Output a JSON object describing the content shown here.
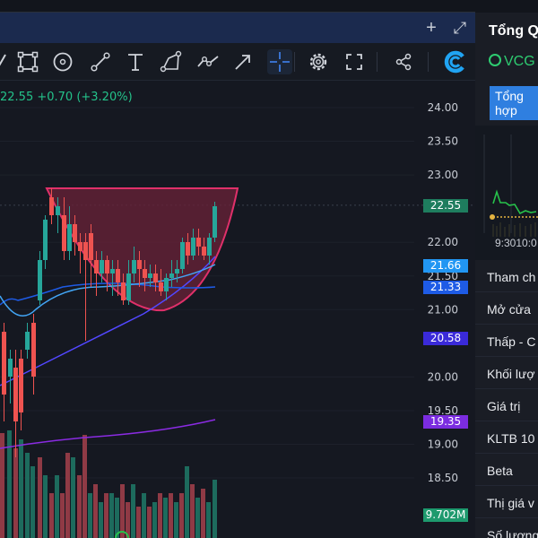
{
  "header": {
    "add_label": "+",
    "expand_label": "⤢"
  },
  "toolbar": {
    "tools": [
      "measure-tool",
      "rectangle-tool",
      "circle-tool",
      "line-tool",
      "text-tool",
      "shape-tool",
      "path-tool",
      "arrow-tool",
      "crosshair-tool",
      "settings",
      "fullscreen",
      "share",
      "logo"
    ]
  },
  "chart": {
    "info": "22.55 +0.70 (+3.20%)",
    "price_axis": [
      "24.00",
      "23.50",
      "23.00",
      "22.00",
      "21.50",
      "21.00",
      "20.00",
      "19.50",
      "19.00",
      "18.50"
    ],
    "labels": {
      "last_price": "22.55",
      "ma1": "21.66",
      "ma2": "21.33",
      "ma3": "20.58",
      "ma4": "19.35",
      "volume": "9.702M"
    },
    "colors": {
      "up": "#26a69a",
      "down": "#ef5350",
      "pattern_fill": "#6b2138",
      "pattern_stroke": "#e0306a",
      "ma1": "#42a5f5",
      "ma2": "#1e5be6",
      "ma3": "#5247ff",
      "ma4": "#8a2be2"
    }
  },
  "panel": {
    "title": "Tổng Q",
    "ticker": "VCG",
    "tab_label": "Tổng hợp",
    "mini_time": "9:3010:0",
    "rows": [
      "Tham ch",
      "Mở cửa",
      "Thấp - C",
      "Khối lượ",
      "Giá trị",
      "KLTB 10",
      "Beta",
      "Thị giá v",
      "Số lượng"
    ]
  }
}
